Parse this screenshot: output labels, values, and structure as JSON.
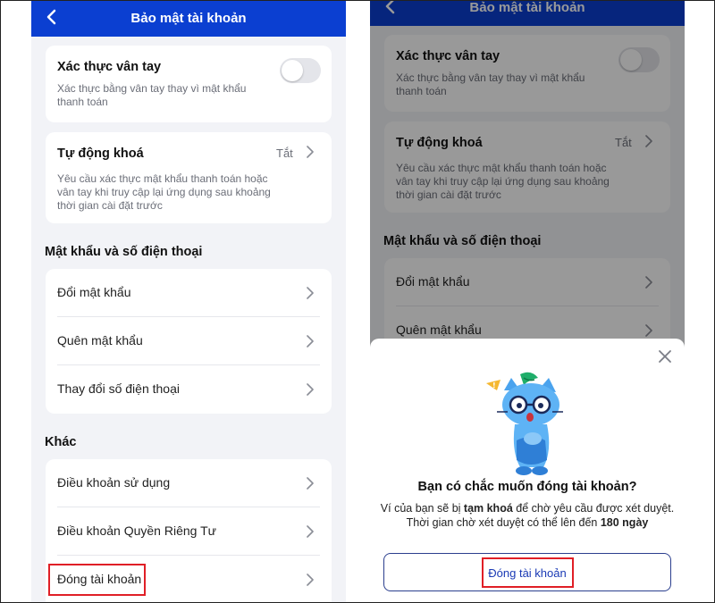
{
  "left": {
    "header": {
      "title": "Bảo mật tài khoản",
      "back_icon": "chevron-left-icon"
    },
    "fingerprint": {
      "title": "Xác thực vân tay",
      "desc_line1": "Xác thực bằng vân tay thay vì mật khẩu",
      "desc_line2": "thanh toán",
      "toggle_on": false
    },
    "autolock": {
      "title": "Tự động khoá",
      "value": "Tắt",
      "desc_line1": "Yêu cầu xác thực mật khẩu thanh toán hoặc",
      "desc_line2": "vân tay khi truy cập lại ứng dụng sau khoảng",
      "desc_line3": "thời gian cài đặt trước"
    },
    "section_password": {
      "title": "Mật khẩu và số điện thoại",
      "items": [
        "Đổi mật khẩu",
        "Quên mật khẩu",
        "Thay đổi số điện thoại"
      ]
    },
    "section_other": {
      "title": "Khác",
      "items": [
        "Điều khoản sử dụng",
        "Điều khoản Quyền Riêng Tư",
        "Đóng tài khoản"
      ]
    }
  },
  "right": {
    "header": {
      "title": "Bảo mật tài khoản",
      "back_icon": "chevron-left-icon"
    },
    "fingerprint": {
      "title": "Xác thực vân tay",
      "desc_line1": "Xác thực bằng vân tay thay vì mật khẩu",
      "desc_line2": "thanh toán"
    },
    "autolock": {
      "title": "Tự động khoá",
      "value": "Tắt",
      "desc_line1": "Yêu cầu xác thực mật khẩu thanh toán hoặc",
      "desc_line2": "vân tay khi truy cập lại ứng dụng sau khoảng",
      "desc_line3": "thời gian cài đặt trước"
    },
    "section_password": {
      "title": "Mật khẩu và số điện thoại",
      "items": [
        "Đổi mật khẩu",
        "Quên mật khẩu"
      ]
    },
    "dialog": {
      "title": "Bạn có chắc muốn đóng tài khoản?",
      "line1_pre": "Ví của bạn sẽ bị ",
      "line1_bold": "tạm khoá",
      "line1_post": " để chờ yêu cầu được xét duyệt.",
      "line2_pre": "Thời gian chờ xét duyệt có thể lên đến ",
      "line2_bold": "180 ngày",
      "button_label": "Đóng tài khoản",
      "close_icon": "close-icon",
      "mascot": "cat-mascot-illustration"
    }
  },
  "colors": {
    "brand_blue": "#0b3fd1",
    "highlight_red": "#e01f26",
    "background": "#f2f3f7"
  }
}
